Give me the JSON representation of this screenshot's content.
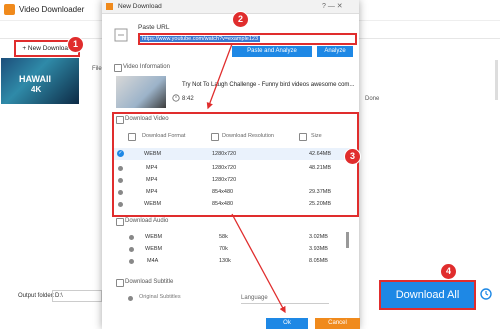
{
  "background_app": {
    "title": "Video Downloader",
    "new_download_label": "+ New Download",
    "thumbnail_text": {
      "line1": "HAWAII",
      "line2": "4K"
    },
    "file_label": "File",
    "done_label": "Done",
    "output_folder_label": "Output folder:",
    "output_folder_value": "D:\\",
    "download_all_label": "Download All"
  },
  "dialog": {
    "title": "New Download",
    "window_controls": "?  —  ✕",
    "paste_url_label": "Paste URL",
    "url_value": "https://www.youtube.com/watch?v=example123",
    "paste_analyze_label": "Paste and Analyze",
    "analyze_label": "Analyze",
    "video_info": {
      "section_label": "Video Information",
      "title": "Try Not To Laugh Challenge - Funny bird videos awesome com...",
      "duration": "8:42"
    },
    "download_video": {
      "section_label": "Download Video",
      "headers": {
        "format": "Download Format",
        "resolution": "Download Resolution",
        "size": "Size"
      },
      "rows": [
        {
          "format": "WEBM",
          "resolution": "1280x720",
          "size": "42.64MB",
          "selected": true
        },
        {
          "format": "MP4",
          "resolution": "1280x720",
          "size": "48.21MB",
          "selected": false
        },
        {
          "format": "MP4",
          "resolution": "1280x720",
          "size": "",
          "selected": false
        },
        {
          "format": "MP4",
          "resolution": "854x480",
          "size": "29.37MB",
          "selected": false
        },
        {
          "format": "WEBM",
          "resolution": "854x480",
          "size": "25.20MB",
          "selected": false
        }
      ]
    },
    "download_audio": {
      "section_label": "Download Audio",
      "rows": [
        {
          "format": "WEBM",
          "bitrate": "58k",
          "size": "3.02MB"
        },
        {
          "format": "WEBM",
          "bitrate": "70k",
          "size": "3.93MB"
        },
        {
          "format": "M4A",
          "bitrate": "130k",
          "size": "8.05MB"
        }
      ]
    },
    "download_subtitle": {
      "section_label": "Download Subtitle",
      "original_label": "Original Subtitles",
      "language_placeholder": "Language"
    },
    "ok_label": "Ok",
    "cancel_label": "Cancel"
  },
  "markers": [
    "1",
    "2",
    "3",
    "4"
  ],
  "colors": {
    "accent": "#1e88e5",
    "highlight": "#e02d2d",
    "brand": "#f08a1c"
  }
}
